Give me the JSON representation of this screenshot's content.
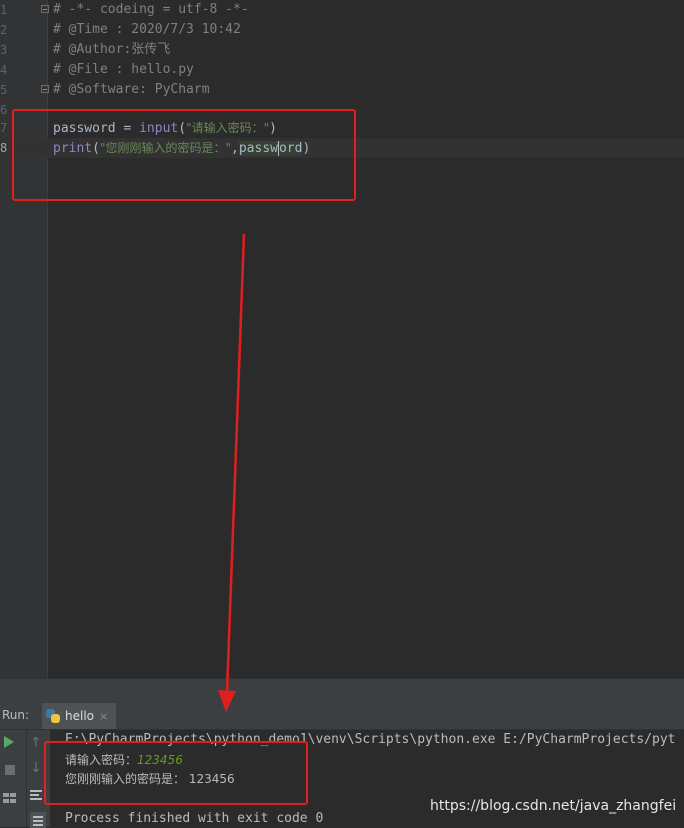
{
  "editor": {
    "lines": [
      {
        "num": "1",
        "text": "# -*- codeing = utf-8 -*-"
      },
      {
        "num": "2",
        "text": "# @Time : 2020/7/3 10:42"
      },
      {
        "num": "3",
        "text": "# @Author:张传飞"
      },
      {
        "num": "4",
        "text": "# @File : hello.py"
      },
      {
        "num": "5",
        "text": "# @Software: PyCharm"
      },
      {
        "num": "6",
        "text": ""
      },
      {
        "num": "7",
        "parts": {
          "var": "password",
          "op": " = ",
          "fn": "input",
          "open": "(",
          "str": "\"请输入密码：\"",
          "close": ")"
        }
      },
      {
        "num": "8",
        "parts": {
          "fn": "print",
          "open": "(",
          "str": "\"您刚刚输入的密码是：\"",
          "comma": ",",
          "arg_a": "passw",
          "arg_b": "ord",
          "close": ")"
        }
      }
    ]
  },
  "run_panel": {
    "label": "Run:",
    "tab_label": "hello",
    "close_glyph": "×",
    "console": {
      "command": "E:\\PyCharmProjects\\python_demo1\\venv\\Scripts\\python.exe E:/PyCharmProjects/pyt",
      "prompt": "请输入密码：",
      "input_value": "123456",
      "output": "您刚刚输入的密码是： 123456",
      "exit": "Process finished with exit code 0"
    },
    "icons": [
      "play-icon",
      "stop-icon",
      "arrow-up-icon",
      "arrow-down-icon",
      "layout-icon",
      "soft-wrap-icon",
      "scroll-to-end-icon"
    ]
  },
  "watermark": "https://blog.csdn.net/java_zhangfei",
  "colors": {
    "annotation": "#e02020",
    "string": "#6a8759",
    "builtin": "#8888c6",
    "comment": "#808080",
    "run_icon": "#59a869"
  }
}
